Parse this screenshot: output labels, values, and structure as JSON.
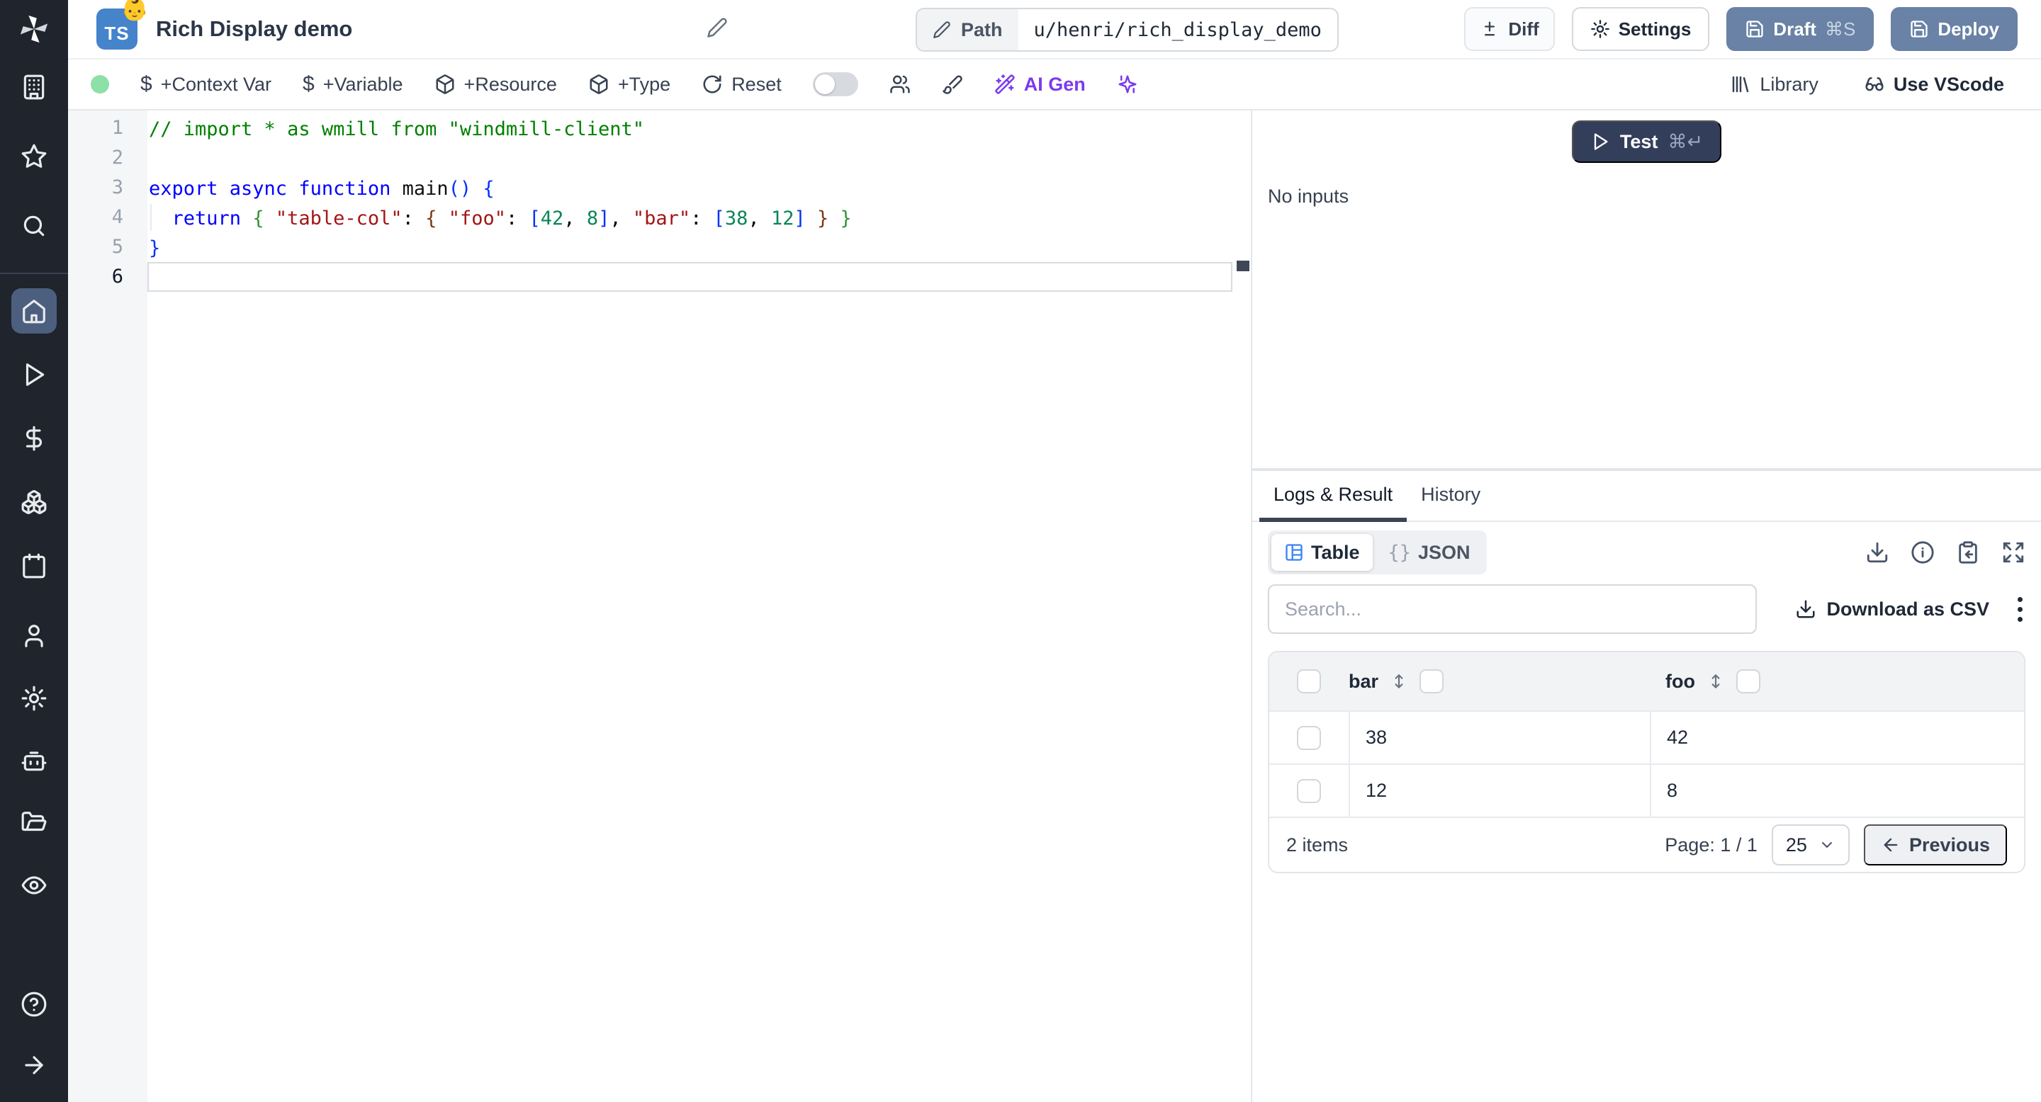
{
  "topbar": {
    "language_badge": "TS",
    "badge_emoji": "👶",
    "title": "Rich Display demo",
    "path_label": "Path",
    "path_value": "u/henri/rich_display_demo",
    "diff_label": "Diff",
    "settings_label": "Settings",
    "draft_label": "Draft",
    "draft_shortcut": "⌘S",
    "deploy_label": "Deploy"
  },
  "toolbar": {
    "context_var_label": "+Context Var",
    "variable_label": "+Variable",
    "resource_label": "+Resource",
    "type_label": "+Type",
    "reset_label": "Reset",
    "ai_gen_label": "AI Gen",
    "library_label": "Library",
    "vscode_label": "Use VScode",
    "dollar_glyph": "$"
  },
  "editor": {
    "active_line": 6,
    "lines": [
      {
        "n": "1",
        "tokens": [
          {
            "t": "// import * as wmill from \"windmill-client\"",
            "c": "comment"
          }
        ]
      },
      {
        "n": "2",
        "tokens": []
      },
      {
        "n": "3",
        "tokens": [
          {
            "t": "export async function ",
            "c": "keyword"
          },
          {
            "t": "main",
            "c": "func"
          },
          {
            "t": "() {",
            "c": "b1"
          }
        ]
      },
      {
        "n": "4",
        "tokens": [
          {
            "t": "  ",
            "c": "plain"
          },
          {
            "t": "return",
            "c": "keyword"
          },
          {
            "t": " ",
            "c": "plain"
          },
          {
            "t": "{",
            "c": "b2"
          },
          {
            "t": " ",
            "c": "plain"
          },
          {
            "t": "\"table-col\"",
            "c": "string"
          },
          {
            "t": ": ",
            "c": "plain"
          },
          {
            "t": "{",
            "c": "b3"
          },
          {
            "t": " ",
            "c": "plain"
          },
          {
            "t": "\"foo\"",
            "c": "string"
          },
          {
            "t": ": ",
            "c": "plain"
          },
          {
            "t": "[",
            "c": "b1"
          },
          {
            "t": "42",
            "c": "number"
          },
          {
            "t": ", ",
            "c": "plain"
          },
          {
            "t": "8",
            "c": "number"
          },
          {
            "t": "]",
            "c": "b1"
          },
          {
            "t": ", ",
            "c": "plain"
          },
          {
            "t": "\"bar\"",
            "c": "string"
          },
          {
            "t": ": ",
            "c": "plain"
          },
          {
            "t": "[",
            "c": "b1"
          },
          {
            "t": "38",
            "c": "number"
          },
          {
            "t": ", ",
            "c": "plain"
          },
          {
            "t": "12",
            "c": "number"
          },
          {
            "t": "]",
            "c": "b1"
          },
          {
            "t": " ",
            "c": "plain"
          },
          {
            "t": "}",
            "c": "b3"
          },
          {
            "t": " ",
            "c": "plain"
          },
          {
            "t": "}",
            "c": "b2"
          }
        ]
      },
      {
        "n": "5",
        "tokens": [
          {
            "t": "}",
            "c": "b1"
          }
        ]
      },
      {
        "n": "6",
        "tokens": []
      }
    ]
  },
  "run_panel": {
    "test_label": "Test",
    "test_shortcut": "⌘↵",
    "no_inputs_label": "No inputs"
  },
  "result_panel": {
    "tabs": [
      {
        "label": "Logs & Result"
      },
      {
        "label": "History"
      }
    ],
    "view_modes": {
      "table_label": "Table",
      "json_braces": "{}",
      "json_label": "JSON"
    },
    "search_placeholder": "Search...",
    "download_csv_label": "Download as CSV",
    "table": {
      "columns": [
        "bar",
        "foo"
      ],
      "rows": [
        [
          "38",
          "42"
        ],
        [
          "12",
          "8"
        ]
      ],
      "items_count_label": "2 items",
      "page_label": "Page: 1 / 1",
      "page_size_value": "25",
      "previous_label": "Previous"
    }
  },
  "colors": {
    "accent_slate": "#6982a5",
    "test_button": "#333e5a",
    "ai_purple": "#7c3aed",
    "status_green": "#8ce0a8",
    "table_icon_blue": "#3b82f6",
    "sidebar_bg": "#1f242d"
  }
}
